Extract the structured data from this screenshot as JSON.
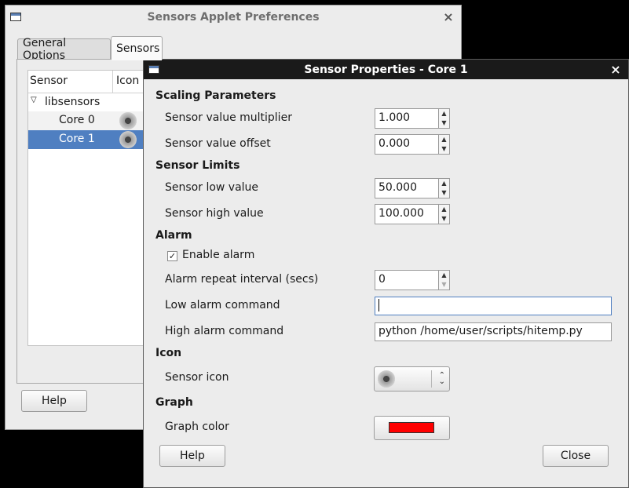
{
  "back_window": {
    "title": "Sensors Applet Preferences",
    "close_glyph": "×",
    "tabs": [
      "General Options",
      "Sensors"
    ],
    "tree": {
      "headers": [
        "Sensor",
        "Icon"
      ],
      "root_label": "libsensors",
      "rows": [
        {
          "label": "Core 0",
          "icon": "fan-icon",
          "selected": false
        },
        {
          "label": "Core 1",
          "icon": "fan-icon",
          "selected": true
        }
      ]
    },
    "help_label": "Help"
  },
  "dialog": {
    "title": "Sensor Properties - Core 1",
    "close_glyph": "×",
    "scaling": {
      "heading": "Scaling Parameters",
      "multiplier_label": "Sensor value multiplier",
      "multiplier_value": "1.000",
      "offset_label": "Sensor value offset",
      "offset_value": "0.000"
    },
    "limits": {
      "heading": "Sensor Limits",
      "low_label": "Sensor low value",
      "low_value": "50.000",
      "high_label": "Sensor high value",
      "high_value": "100.000"
    },
    "alarm": {
      "heading": "Alarm",
      "enable_label": "Enable alarm",
      "enable_checked": true,
      "check_glyph": "✓",
      "repeat_label": "Alarm repeat interval (secs)",
      "repeat_value": "0",
      "low_cmd_label": "Low alarm command",
      "low_cmd_value": "",
      "high_cmd_label": "High alarm command",
      "high_cmd_value": "python /home/user/scripts/hitemp.py"
    },
    "icon": {
      "heading": "Icon",
      "sensor_icon_label": "Sensor icon",
      "selected_icon": "fan-icon"
    },
    "graph": {
      "heading": "Graph",
      "color_label": "Graph color",
      "color_value": "#ff0000"
    },
    "help_label": "Help",
    "close_label": "Close"
  }
}
